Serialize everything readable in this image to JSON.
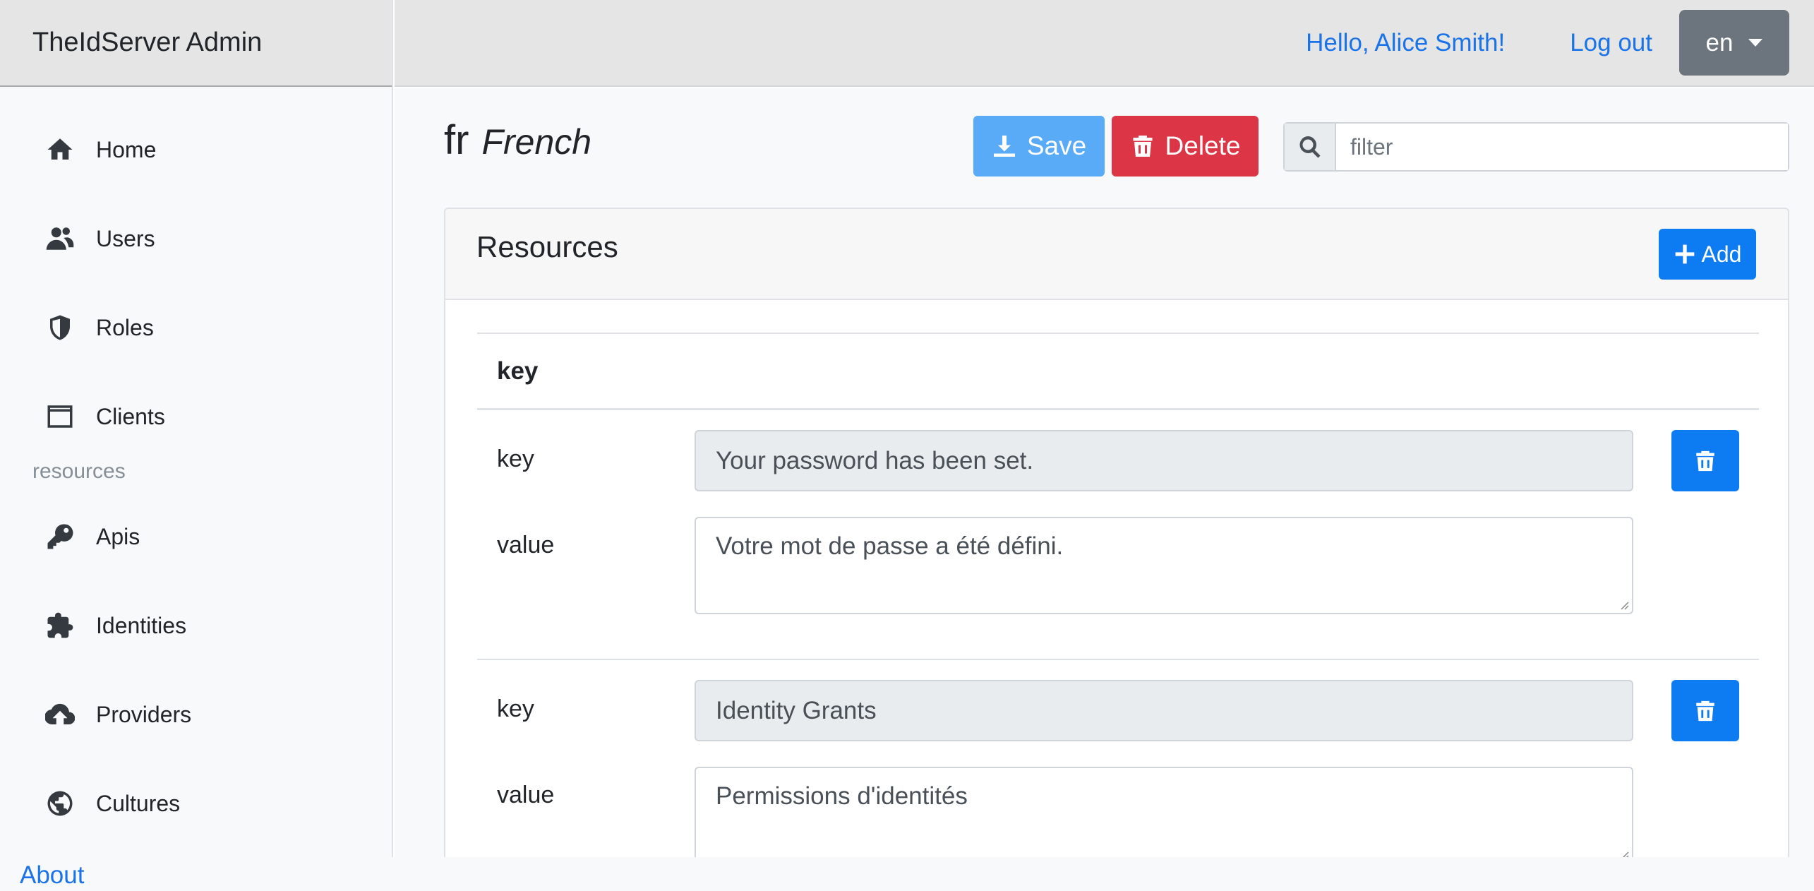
{
  "app": {
    "brand": "TheIdServer Admin"
  },
  "sidebar": {
    "items": [
      {
        "label": "Home",
        "icon": "home-icon"
      },
      {
        "label": "Users",
        "icon": "users-icon"
      },
      {
        "label": "Roles",
        "icon": "shield-icon"
      },
      {
        "label": "Clients",
        "icon": "window-icon"
      }
    ],
    "section_label": "resources",
    "resource_items": [
      {
        "label": "Apis",
        "icon": "key-icon"
      },
      {
        "label": "Identities",
        "icon": "puzzle-icon"
      },
      {
        "label": "Providers",
        "icon": "cloud-upload-icon"
      },
      {
        "label": "Cultures",
        "icon": "globe-icon"
      }
    ]
  },
  "topbar": {
    "greeting": "Hello, Alice Smith!",
    "logout": "Log out",
    "language": "en"
  },
  "page": {
    "code": "fr",
    "name": "French",
    "save_label": "Save",
    "delete_label": "Delete",
    "filter_placeholder": "filter"
  },
  "resources": {
    "title": "Resources",
    "add_label": "Add",
    "column_header": "key",
    "key_label": "key",
    "value_label": "value",
    "rows": [
      {
        "key": "Your password has been set.",
        "value": "Votre mot de passe a été défini."
      },
      {
        "key": "Identity Grants",
        "value": "Permissions d'identités"
      }
    ]
  },
  "footer": {
    "about": "About"
  },
  "colors": {
    "primary": "#0d7cf2",
    "danger": "#dc3545",
    "save": "#5aabf7",
    "secondary": "#6c757d",
    "link": "#1a73e8"
  }
}
